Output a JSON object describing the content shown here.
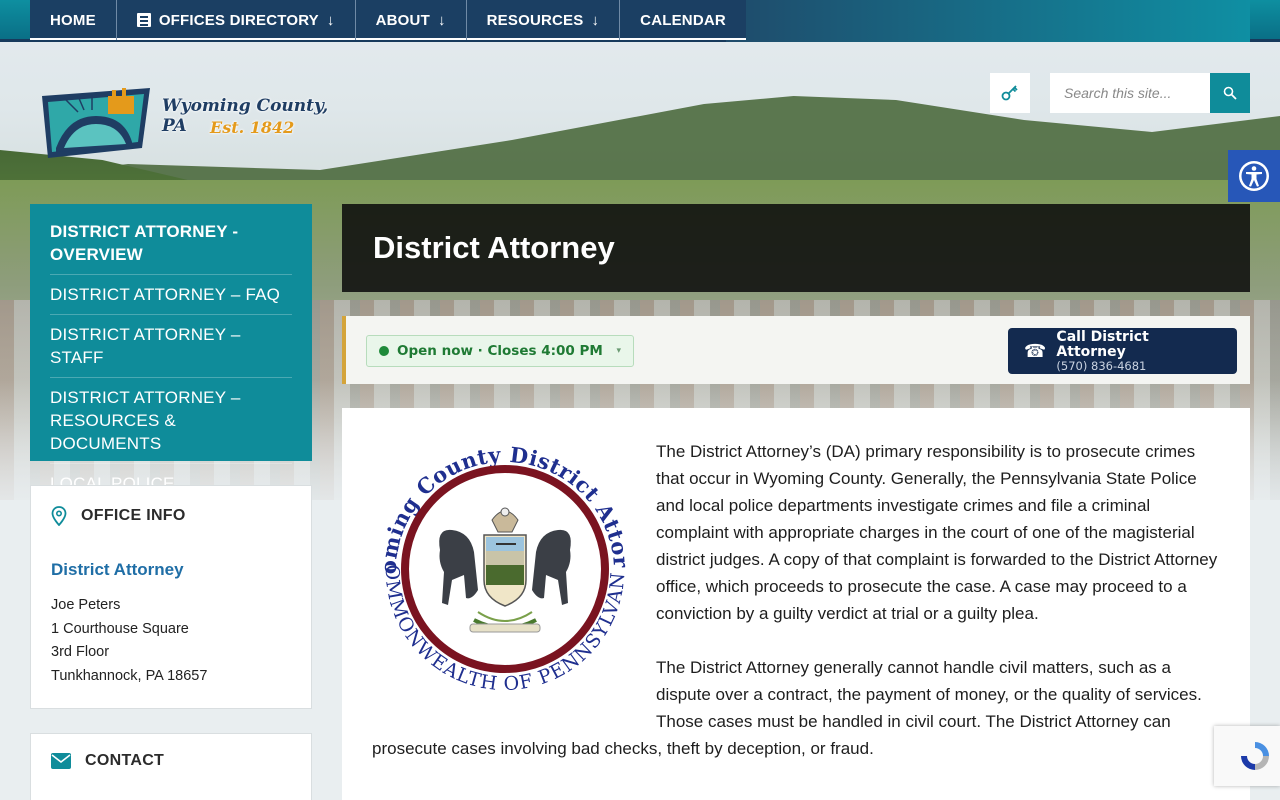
{
  "nav": {
    "items": [
      {
        "label": "HOME"
      },
      {
        "label": "OFFICES DIRECTORY"
      },
      {
        "label": "ABOUT"
      },
      {
        "label": "RESOURCES"
      },
      {
        "label": "CALENDAR"
      }
    ],
    "dropdown_arrow": "↓"
  },
  "logo": {
    "line1": "Wyoming County, PA",
    "line2": "Est. 1842"
  },
  "search": {
    "placeholder": "Search this site..."
  },
  "sidebar": {
    "items": [
      {
        "label": "DISTRICT ATTORNEY - OVERVIEW"
      },
      {
        "label": "DISTRICT ATTORNEY – FAQ"
      },
      {
        "label": "DISTRICT ATTORNEY – STAFF"
      },
      {
        "label": "DISTRICT ATTORNEY – RESOURCES & DOCUMENTS"
      },
      {
        "label": "LOCAL POLICE DEPARTMENTS"
      }
    ]
  },
  "office_info": {
    "title": "OFFICE INFO",
    "office_name": "District Attorney",
    "person": "Joe Peters",
    "address1": "1 Courthouse Square",
    "address2": "3rd Floor",
    "city": "Tunkhannock, PA 18657"
  },
  "contact": {
    "title": "CONTACT"
  },
  "page": {
    "title": "District Attorney"
  },
  "status": {
    "open_text": "Open now · Closes 4:00 PM",
    "caret": "▾",
    "call_label": "Call District Attorney",
    "phone": "(570) 836-4681",
    "phone_glyph": "☎"
  },
  "seal": {
    "top_text": "Wyoming County District Attorney",
    "bottom_text": "COMMONWEALTH OF PENNSYLVANIA"
  },
  "content": {
    "paragraph1": "The District Attorney’s (DA) primary responsibility is to prosecute crimes that occur in Wyoming County. Generally, the Pennsylvania State Police and local police departments investigate crimes and file a criminal complaint with appropriate charges in the court of one of the magisterial district judges. A copy of that complaint is forwarded to the District Attorney office, which proceeds to prosecute the case. A case may proceed to a conviction by a guilty verdict at trial or a guilty plea.",
    "paragraph2": "The District Attorney generally cannot handle civil matters, such as a dispute over a contract, the payment of money, or the quality of services. Those cases must be handled in civil court. The District Attorney can prosecute cases involving bad checks, theft by deception, or fraud."
  },
  "colors": {
    "teal": "#0f8c9a",
    "navy": "#1b3f63",
    "dark_navy": "#132a4f",
    "link_blue": "#1f6ea6",
    "open_green": "#1f7a34",
    "accent_gold": "#d4a43a",
    "seal_red": "#7a1320",
    "seal_blue": "#1f2f8f"
  },
  "icons": {
    "offices_directory": "document-icon",
    "login": "key-icon",
    "search": "search-icon",
    "accessibility": "accessibility-icon",
    "office_info": "map-pin-icon",
    "contact": "envelope-icon",
    "call": "phone-icon",
    "recaptcha": "recaptcha-icon"
  }
}
